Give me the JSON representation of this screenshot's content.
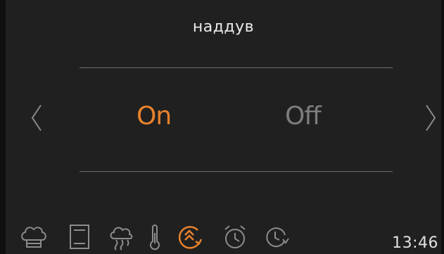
{
  "header": {
    "title": "наддув"
  },
  "selector": {
    "options": [
      {
        "label": "On",
        "selected": true
      },
      {
        "label": "Off",
        "selected": false
      }
    ]
  },
  "bottom_bar": {
    "icons": [
      "chef-hat-icon",
      "oven-door-icon",
      "cloud-steam-icon",
      "thermometer-icon",
      "fan-boost-icon",
      "alarm-clock-icon",
      "clock-timer-icon"
    ],
    "active_icon": "fan-boost-icon",
    "time": "13:46"
  },
  "colors": {
    "accent": "#e8822c",
    "inactive": "#7d7d7d",
    "background": "#202020",
    "text": "#eaeaea"
  }
}
